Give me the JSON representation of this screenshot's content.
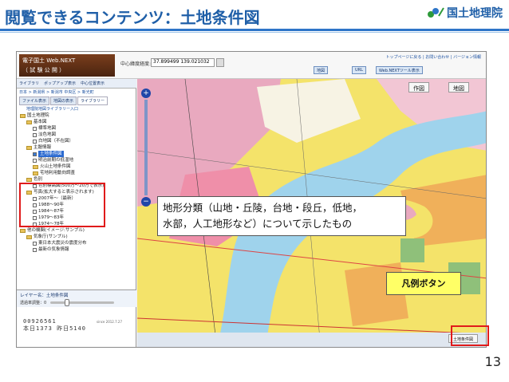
{
  "slide": {
    "title": "閲覧できるコンテンツ：土地条件図",
    "brand": "国土地理院",
    "page_number": "13"
  },
  "app": {
    "logo_line1": "電子国土 Web.NEXT",
    "logo_line2": "（ 試 験 公 開 ）",
    "coord_label": "中心緯度経度:",
    "coord_value": "37.899499 139.021032",
    "top_links": "トップページに戻る | お問い合わせ | バージョン情報",
    "toolbar": [
      "地図",
      "URL",
      "Web.NEXTツール表示"
    ],
    "tabs": [
      "ライブラリ",
      "ポップアップ表示",
      "中心位置表示"
    ],
    "breadcrumb": "日本 > 新潟県 > 新潟市 中央区 > 新光町",
    "sidebar_tabs": [
      "ファイル表示",
      "地図の表示",
      "ライブラリー"
    ],
    "tree_title": "地理院地図ライブラリー入口",
    "tree": [
      {
        "label": "国土地理院",
        "type": "folder",
        "indent": 0
      },
      {
        "label": "基本図",
        "type": "folder",
        "indent": 1
      },
      {
        "label": "標準地図",
        "type": "check",
        "indent": 2
      },
      {
        "label": "淡色地図",
        "type": "check",
        "indent": 2
      },
      {
        "label": "白地図（不在図）",
        "type": "check",
        "indent": 2
      },
      {
        "label": "主題情報",
        "type": "folder",
        "indent": 1
      },
      {
        "label": "土地条件図",
        "type": "selected",
        "indent": 2
      },
      {
        "label": "明治前期の低湿地",
        "type": "check",
        "indent": 2
      },
      {
        "label": "火山土地条件図",
        "type": "folder",
        "indent": 2
      },
      {
        "label": "宅地利用動向調査",
        "type": "folder",
        "indent": 2
      },
      {
        "label": "色別",
        "type": "folder",
        "indent": 1
      },
      {
        "label": "色別標高図(500万～20万で表示)",
        "type": "check",
        "indent": 2
      },
      {
        "label": "写真(拡大すると表示されます)",
        "type": "folder",
        "indent": 1
      },
      {
        "label": "2007年～（最新）",
        "type": "check",
        "indent": 2
      },
      {
        "label": "1988～90年",
        "type": "check",
        "indent": 2
      },
      {
        "label": "1984～87年",
        "type": "check",
        "indent": 2
      },
      {
        "label": "1979～83年",
        "type": "check",
        "indent": 2
      },
      {
        "label": "1974～78年",
        "type": "check",
        "indent": 2
      },
      {
        "label": "他の機関(イメージ:サンプル)",
        "type": "folder",
        "indent": 0
      },
      {
        "label": "気象庁(サンプル)",
        "type": "folder",
        "indent": 1
      },
      {
        "label": "東日本大震災の震度分布",
        "type": "check",
        "indent": 2
      },
      {
        "label": "最新の気象情報",
        "type": "check",
        "indent": 2
      }
    ],
    "layer_title": "レイヤー名：土地条件図",
    "opacity_label": "透過率調整：0",
    "counter_line1": "00926561",
    "counter_line2": "本日1373 昨日5140",
    "since": "since 2012.7.27",
    "map_tabs": [
      "作図",
      "地図"
    ],
    "map_bottom": "土地条件図"
  },
  "annotations": {
    "callout_line1": "地形分類（山地・丘陵，台地・段丘，低地，",
    "callout_line2": "水部，人工地形など）について示したもの",
    "legend_label": "凡例ボタン"
  },
  "colors": {
    "title_blue": "#1f5fa8",
    "highlight_red": "#e01b1b",
    "legend_yellow": "#ffff66",
    "water": "#9fd3ec",
    "lowland_yellow": "#f4e36a",
    "upland_pink": "#e9a9bf",
    "terrace_orange": "#f0b05a"
  }
}
